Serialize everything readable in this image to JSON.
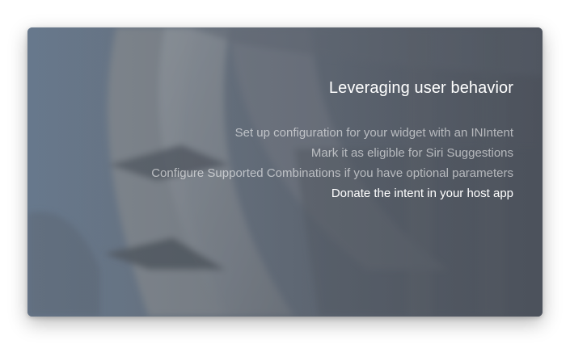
{
  "slide": {
    "title": "Leveraging user behavior",
    "steps": [
      {
        "label": "Set up configuration for your widget with an INIntent",
        "active": false
      },
      {
        "label": "Mark it as eligible for Siri Suggestions",
        "active": false
      },
      {
        "label": "Configure Supported Combinations if you have optional parameters",
        "active": false
      },
      {
        "label": "Donate the intent in your host app",
        "active": true
      }
    ]
  },
  "colors": {
    "title_text": "#ffffff",
    "inactive_text": "#c7cbd1",
    "active_text": "#ffffff",
    "card_background": "#66727f"
  }
}
